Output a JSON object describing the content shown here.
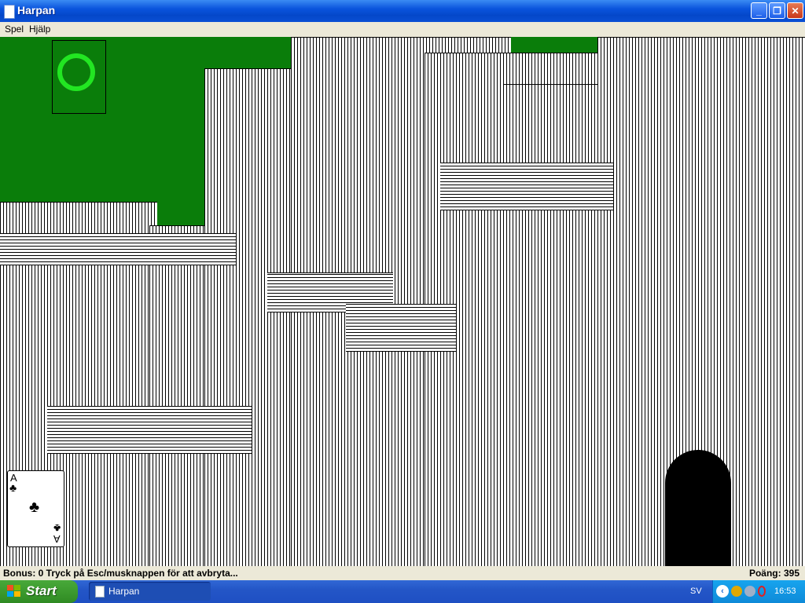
{
  "window": {
    "title": "Harpan"
  },
  "menu": {
    "items": [
      "Spel",
      "Hjälp"
    ]
  },
  "card": {
    "rank": "A",
    "suit": "♣"
  },
  "status": {
    "left": "Bonus: 0  Tryck på Esc/musknappen för att avbryta...",
    "right": "Poäng: 395"
  },
  "taskbar": {
    "start_label": "Start",
    "task_label": "Harpan",
    "language": "SV",
    "clock": "16:53"
  },
  "icons": {
    "minimize": "minimize-icon",
    "maximize": "maximize-icon",
    "close": "close-icon",
    "windows": "windows-flag-icon"
  }
}
